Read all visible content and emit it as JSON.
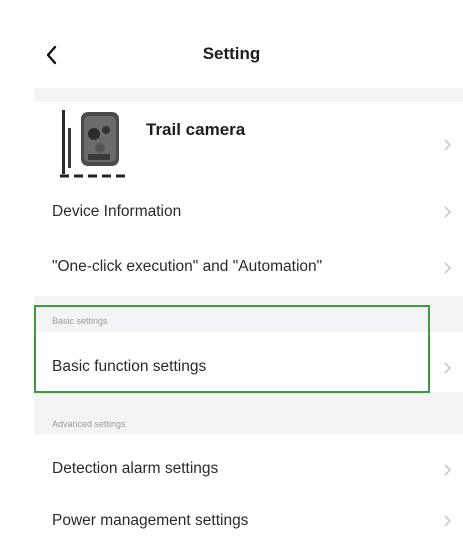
{
  "nav": {
    "title": "Setting",
    "back_icon": "chevron-left-icon"
  },
  "device": {
    "name": "Trail camera",
    "image": "trail-camera-thumbnail"
  },
  "rows": {
    "device_information": "Device Information",
    "one_click": "\"One-click execution\" and \"Automation\"",
    "basic_function": "Basic function settings",
    "detection_alarm": "Detection alarm settings",
    "power_management": "Power management settings"
  },
  "sections": {
    "basic": "Basic settings",
    "advanced": "Advanced settings"
  },
  "colors": {
    "highlight_border": "#3f9a3f",
    "section_bg": "#f4f4f6",
    "chevron": "#c8c8c8"
  }
}
